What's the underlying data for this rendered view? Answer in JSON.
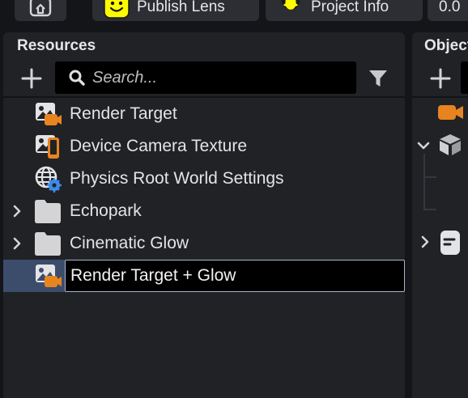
{
  "toolbar": {
    "home_icon": "lens-home-icon",
    "publish_label": "Publish Lens",
    "publish_icon": "snapchat-ghost-icon",
    "publish_icon_color": "#FFFC00",
    "project_label": "Project Info",
    "project_icon": "snapchat-ghost-icon",
    "version_label": "0.0"
  },
  "resources": {
    "title": "Resources",
    "search_placeholder": "Search...",
    "search_value": "",
    "items": [
      {
        "label": "Render Target",
        "icon": "render-target-icon",
        "expandable": false
      },
      {
        "label": "Device Camera Texture",
        "icon": "device-camera-texture-icon",
        "expandable": false
      },
      {
        "label": "Physics Root World Settings",
        "icon": "physics-world-settings-icon",
        "expandable": false
      },
      {
        "label": "Echopark",
        "icon": "folder-icon",
        "expandable": true
      },
      {
        "label": "Cinematic Glow",
        "icon": "folder-icon",
        "expandable": true
      },
      {
        "label": "Render Target + Glow",
        "icon": "render-target-icon",
        "expandable": false,
        "editing": true,
        "selected": true
      }
    ]
  },
  "objects": {
    "title": "Objects"
  },
  "colors": {
    "accent_orange": "#E8841F",
    "selection_blue": "#3B4D6B",
    "panel_bg": "#202226",
    "app_bg": "#141518"
  }
}
